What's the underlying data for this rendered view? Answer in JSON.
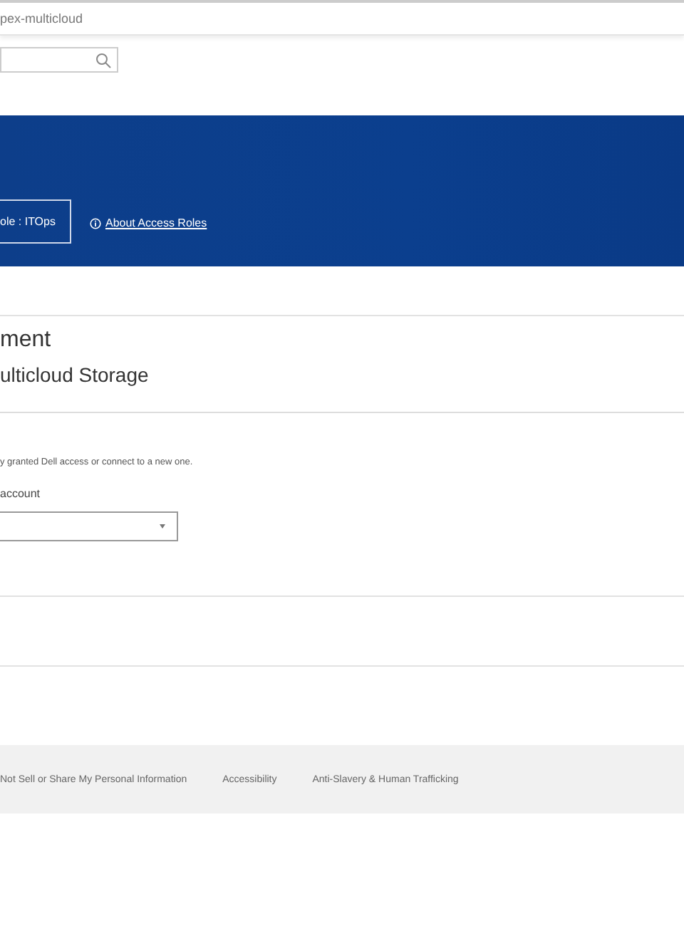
{
  "address_bar": {
    "url": "pex-multicloud"
  },
  "banner": {
    "role_button": "ole :  ITOps",
    "info_link": "About Access Roles"
  },
  "page": {
    "title": "ment",
    "subtitle": "ulticloud Storage"
  },
  "section": {
    "description": "y granted Dell access or connect to a new one.",
    "field_label": "account"
  },
  "footer": {
    "links": [
      "Not Sell or Share My Personal Information",
      "Accessibility",
      "Anti-Slavery & Human Trafficking"
    ]
  }
}
